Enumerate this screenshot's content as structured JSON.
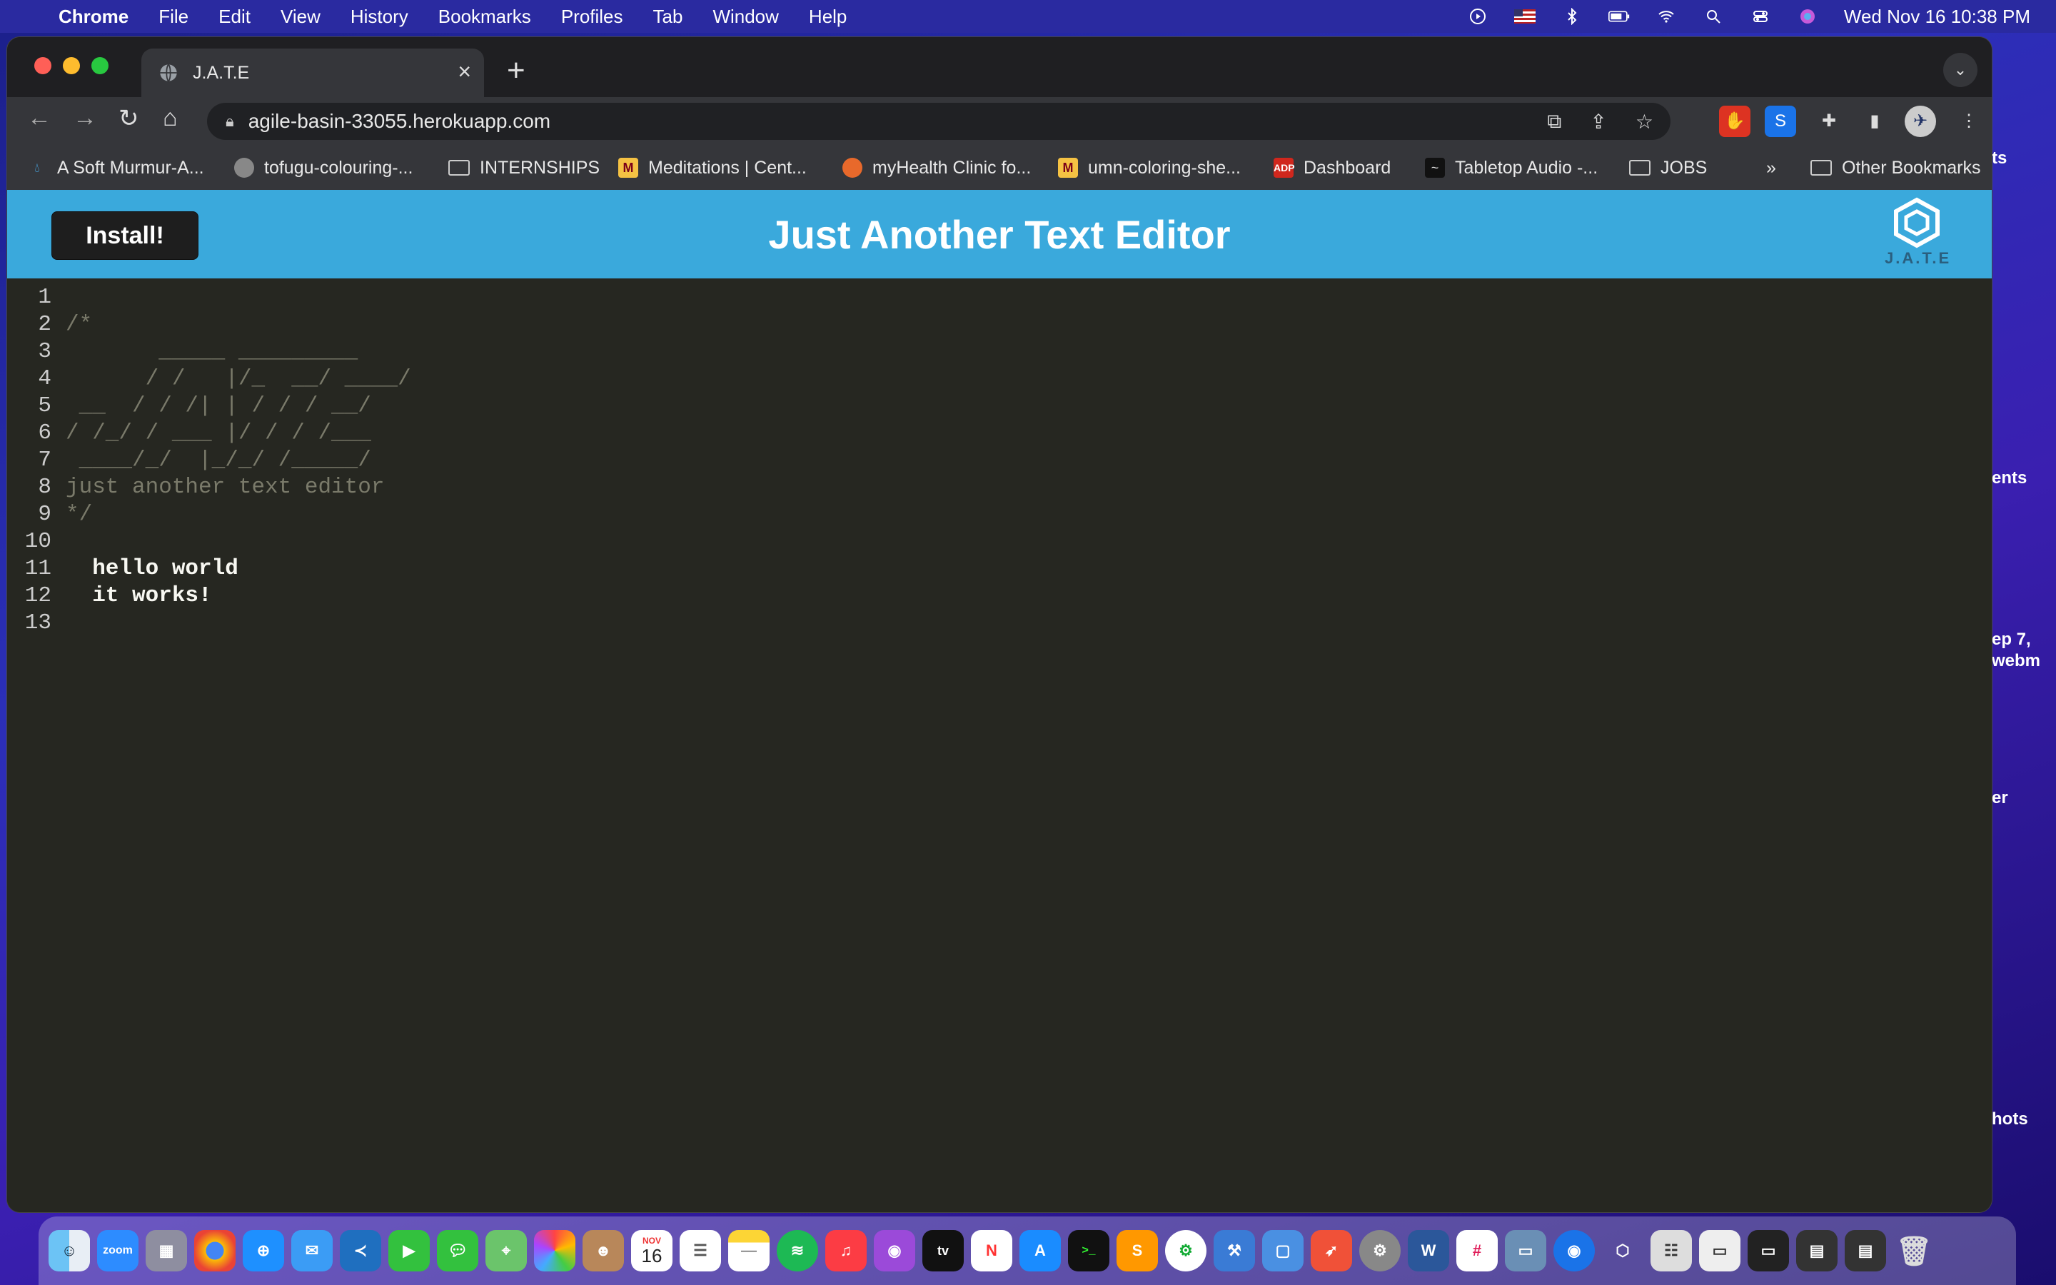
{
  "menubar": {
    "app_name": "Chrome",
    "items": [
      "File",
      "Edit",
      "View",
      "History",
      "Bookmarks",
      "Profiles",
      "Tab",
      "Window",
      "Help"
    ],
    "datetime": "Wed Nov 16  10:38 PM"
  },
  "desktop_side_labels": [
    "ts",
    "ents",
    "ep 7,",
    "webm",
    "er",
    "hots"
  ],
  "browser": {
    "tab_title": "J.A.T.E",
    "url": "agile-basin-33055.herokuapp.com",
    "bookmarks": [
      {
        "label": "A Soft Murmur-A...",
        "icon": "droplet-icon"
      },
      {
        "label": "tofugu-colouring-...",
        "icon": "globe-icon"
      },
      {
        "label": "INTERNSHIPS",
        "icon": "folder-icon"
      },
      {
        "label": "Meditations | Cent...",
        "icon": "umn-icon"
      },
      {
        "label": "myHealth Clinic fo...",
        "icon": "health-icon"
      },
      {
        "label": "umn-coloring-she...",
        "icon": "umn-icon"
      },
      {
        "label": "Dashboard",
        "icon": "adp-icon"
      },
      {
        "label": "Tabletop Audio -...",
        "icon": "tabletop-icon"
      },
      {
        "label": "JOBS",
        "icon": "folder-icon"
      }
    ],
    "overflow_label": "»",
    "other_bookmarks": "Other Bookmarks"
  },
  "app": {
    "install_label": "Install!",
    "title": "Just Another Text Editor",
    "logo_text": "J.A.T.E"
  },
  "editor": {
    "lines": [
      {
        "num": "1",
        "text": "",
        "style": "cmt"
      },
      {
        "num": "2",
        "text": "/*",
        "style": "cmt"
      },
      {
        "num": "3",
        "text": "       _____ _________",
        "style": "cmt"
      },
      {
        "num": "4",
        "text": "      / /   |/_  __/ ____/",
        "style": "cmt"
      },
      {
        "num": "5",
        "text": " __  / / /| | / / / __/",
        "style": "cmt"
      },
      {
        "num": "6",
        "text": "/ /_/ / ___ |/ / / /___",
        "style": "cmt"
      },
      {
        "num": "7",
        "text": " ____/_/  |_/_/ /_____/",
        "style": "cmt"
      },
      {
        "num": "8",
        "text": "just another text editor",
        "style": "cmt"
      },
      {
        "num": "9",
        "text": "*/",
        "style": "cmt"
      },
      {
        "num": "10",
        "text": "",
        "style": "txt"
      },
      {
        "num": "11",
        "text": "  hello world",
        "style": "txt"
      },
      {
        "num": "12",
        "text": "  it works!",
        "style": "txt"
      },
      {
        "num": "13",
        "text": "",
        "style": "txt"
      }
    ]
  },
  "dock": {
    "calendar_month": "NOV",
    "calendar_day": "16",
    "apple_tv": "tv",
    "zoom": "zoom"
  }
}
